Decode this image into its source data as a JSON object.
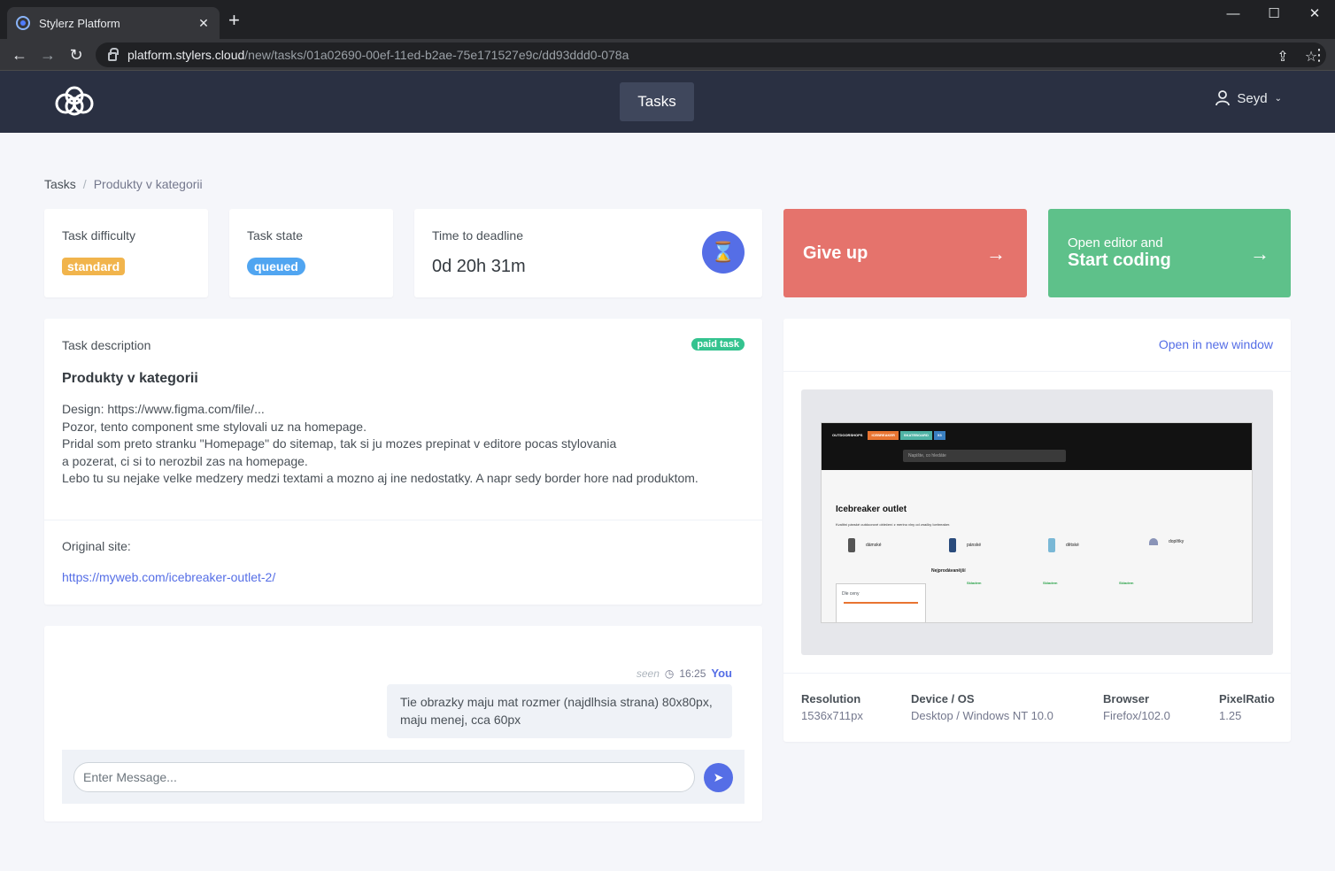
{
  "browser": {
    "tab_title": "Stylerz Platform",
    "tab_close": "✕",
    "new_tab": "+",
    "url_host": "platform.stylers.cloud",
    "url_path": "/new/tasks/01a02690-00ef-11ed-b2ae-75e171527e9c/dd93ddd0-078a",
    "minimize": "—",
    "maximize": "☐",
    "close": "✕"
  },
  "header": {
    "tasks_label": "Tasks",
    "user_name": "Seyd"
  },
  "breadcrumb": {
    "home": "Tasks",
    "current": "Produkty v kategorii"
  },
  "stats": {
    "difficulty_label": "Task difficulty",
    "difficulty_value": "standard",
    "state_label": "Task state",
    "state_value": "queued",
    "deadline_label": "Time to deadline",
    "deadline_value": "0d 20h 31m"
  },
  "actions": {
    "give_up": "Give up",
    "start_small": "Open editor and",
    "start_big": "Start coding"
  },
  "description": {
    "section_label": "Task description",
    "badge": "paid task",
    "title": "Produkty v kategorii",
    "lines": [
      "Design: https://www.figma.com/file/...",
      "Pozor, tento component sme stylovali uz na homepage.",
      "Pridal som preto stranku \"Homepage\" do sitemap, tak si ju mozes prepinat v editore pocas stylovania",
      "a pozerat, ci si to nerozbil zas na homepage.",
      "Lebo tu su nejake velke medzery medzi textami a mozno aj ine nedostatky. A napr sedy border hore nad produktom."
    ],
    "original_label": "Original site:",
    "original_url": "https://myweb.com/icebreaker-outlet-2/"
  },
  "chat": {
    "seen": "seen",
    "time": "16:25",
    "author": "You",
    "message": "Tie obrazky maju mat rozmer (najdlhsia strana) 80x80px, maju menej, cca 60px",
    "placeholder": "Enter Message..."
  },
  "preview": {
    "open_link": "Open in new window",
    "site_nav": [
      "OUTDOORSHOPS",
      "ICEBREAKER",
      "SKATEBOARD",
      "X3"
    ],
    "site_search": "Napište, co hledáte",
    "site_title": "Icebreaker outlet",
    "site_sub": "Kvalitní pánské outdoorové oblečení z merino vlny od značky Icebreaker.",
    "categories": [
      "dámské",
      "pánské",
      "dětské",
      "doplňky"
    ],
    "bestsellers": "Nejprodávanější",
    "filter_label": "Dle ceny",
    "stock": "Skladem"
  },
  "specs": {
    "resolution_label": "Resolution",
    "resolution_value": "1536x711px",
    "device_label": "Device / OS",
    "device_value": "Desktop / Windows NT 10.0",
    "browser_label": "Browser",
    "browser_value": "Firefox/102.0",
    "ratio_label": "PixelRatio",
    "ratio_value": "1.25"
  },
  "colors": {
    "header_bg": "#2a3042",
    "give_up": "#e5736c",
    "start_coding": "#5ec18a",
    "primary": "#556ee6",
    "difficulty": "#f1b44c",
    "state": "#50a5f1",
    "paid": "#34c38f"
  }
}
